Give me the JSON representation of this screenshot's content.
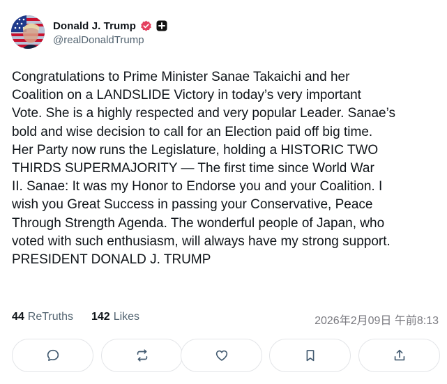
{
  "author": {
    "display_name": "Donald J. Trump",
    "handle": "@realDonaldTrump",
    "verified_color": "#e4405f",
    "icons": [
      "avatar-flag-portrait",
      "verified-badge-icon",
      "plus-badge-icon"
    ]
  },
  "post": {
    "text": "Congratulations to Prime Minister Sanae Takaichi and her\nCoalition on a LANDSLIDE Victory in today’s very important\nVote. She is a highly respected and very popular Leader. Sanae’s\nbold and wise decision to call for an Election paid off big time.\nHer Party now runs the Legislature, holding a HISTORIC TWO\nTHIRDS SUPERMAJORITY — The first time since World War\nII. Sanae: It was my Honor to Endorse you and your Coalition. I\nwish you Great Success in passing your Conservative, Peace\nThrough Strength Agenda. The wonderful people of Japan, who\nvoted with such enthusiasm, will always have my strong support.\nPRESIDENT DONALD J. TRUMP"
  },
  "stats": {
    "retruths_count": "44",
    "retruths_label": "ReTruths",
    "likes_count": "142",
    "likes_label": "Likes",
    "timestamp": "2026年2月09日 午前8:13"
  },
  "actions": [
    {
      "name": "reply",
      "icon": "comment-bubble-icon"
    },
    {
      "name": "retruth",
      "icon": "repost-arrows-icon"
    },
    {
      "name": "like",
      "icon": "heart-icon"
    },
    {
      "name": "save",
      "icon": "bookmark-icon"
    },
    {
      "name": "share",
      "icon": "share-upload-icon"
    }
  ],
  "colors": {
    "text": "#0f1419",
    "muted": "#536471",
    "button_border": "#e3e5e8"
  }
}
